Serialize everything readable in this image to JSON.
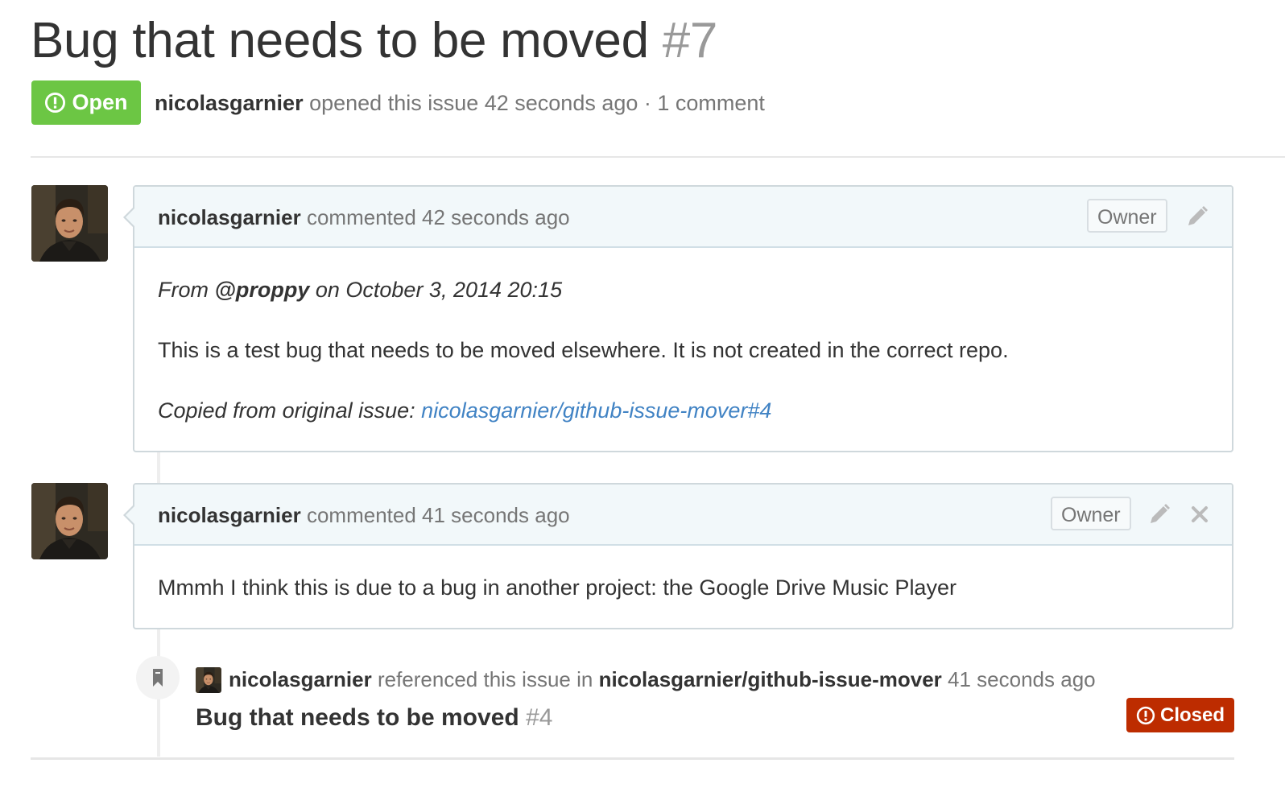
{
  "issue": {
    "title": "Bug that needs to be moved",
    "number": "#7",
    "state": "Open",
    "author": "nicolasgarnier",
    "meta_text": "opened this issue 42 seconds ago · 1 comment"
  },
  "comments": [
    {
      "author": "nicolasgarnier",
      "action": "commented 42 seconds ago",
      "role_badge": "Owner",
      "icons": [
        "pencil-icon"
      ],
      "body": {
        "from_prefix": "From",
        "from_user": "@proppy",
        "from_suffix": "on October 3, 2014 20:15",
        "paragraph": "This is a test bug that needs to be moved elsewhere. It is not created in the correct repo.",
        "copied_prefix": "Copied from original issue:",
        "copied_link": "nicolasgarnier/github-issue-mover#4"
      }
    },
    {
      "author": "nicolasgarnier",
      "action": "commented 41 seconds ago",
      "role_badge": "Owner",
      "icons": [
        "pencil-icon",
        "close-icon"
      ],
      "body": {
        "paragraph": "Mmmh I think this is due to a bug in another project: the Google Drive Music Player"
      }
    }
  ],
  "reference_event": {
    "icon": "bookmark-icon",
    "actor": "nicolasgarnier",
    "action": "referenced this issue in",
    "repo": "nicolasgarnier/github-issue-mover",
    "time": "41 seconds ago",
    "issue_title": "Bug that needs to be moved",
    "issue_number": "#4",
    "issue_state": "Closed"
  },
  "colors": {
    "open": "#6cc644",
    "closed": "#bd2c00",
    "link": "#4183c4",
    "header_bg": "#f2f8fa"
  }
}
